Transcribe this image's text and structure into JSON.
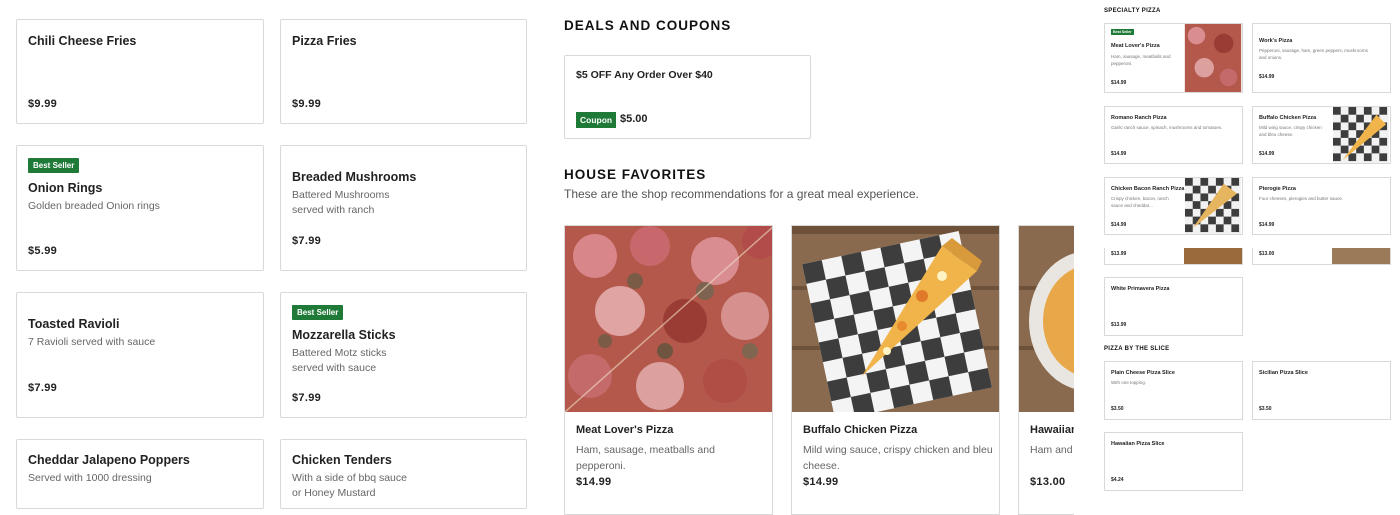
{
  "sides": [
    {
      "title": "Chili Cheese Fries",
      "desc": "",
      "price": "$9.99",
      "badge": ""
    },
    {
      "title": "Pizza Fries",
      "desc": "",
      "price": "$9.99",
      "badge": ""
    },
    {
      "title": "Onion Rings",
      "desc": "Golden breaded Onion rings",
      "price": "$5.99",
      "badge": "Best Seller"
    },
    {
      "title": "Breaded Mushrooms",
      "desc": "Battered Mushrooms served with ranch",
      "price": "$7.99",
      "badge": ""
    },
    {
      "title": "Toasted Ravioli",
      "desc": "7 Ravioli served with sauce",
      "price": "$7.99",
      "badge": ""
    },
    {
      "title": "Mozzarella Sticks",
      "desc": "Battered Motz sticks served with sauce",
      "price": "$7.99",
      "badge": "Best Seller"
    },
    {
      "title": "Cheddar Jalapeno Poppers",
      "desc": "Served with 1000 dressing",
      "price": "",
      "badge": ""
    },
    {
      "title": "Chicken Tenders",
      "desc": "With a side of bbq sauce or Honey Mustard",
      "price": "",
      "badge": ""
    }
  ],
  "deals": {
    "heading": "DEALS AND COUPONS",
    "coupon": {
      "title": "$5 OFF Any Order Over $40",
      "chip": "Coupon",
      "amount": "$5.00"
    }
  },
  "favorites": {
    "heading": "HOUSE FAVORITES",
    "subtitle": "These are the shop recommendations for a great meal experience.",
    "items": [
      {
        "title": "Meat Lover's Pizza",
        "desc": "Ham, sausage, meatballs and pepperoni.",
        "price": "$14.99"
      },
      {
        "title": "Buffalo Chicken Pizza",
        "desc": "Mild wing sauce, crispy chicken and bleu cheese.",
        "price": "$14.99"
      },
      {
        "title": "Hawaiian",
        "desc": "Ham and",
        "price": "$13.00"
      }
    ]
  },
  "mini": {
    "specialty_heading": "SPECIALTY PIZZA",
    "specialty": [
      {
        "title": "Meat Lover's Pizza",
        "desc": "Ham, sausage, meatballs and pepperoni.",
        "price": "$14.99",
        "badge": "Best Seller"
      },
      {
        "title": "Work's Pizza",
        "desc": "Pepperoni, sausage, ham, green peppers, mushrooms and onions.",
        "price": "$14.99",
        "badge": ""
      },
      {
        "title": "Romano Ranch Pizza",
        "desc": "Garlic ranch sauce, spinach, mushrooms and tomatoes.",
        "price": "$14.99",
        "badge": ""
      },
      {
        "title": "Buffalo Chicken Pizza",
        "desc": "Mild wing sauce, crispy chicken and bleu cheese.",
        "price": "$14.99",
        "badge": ""
      },
      {
        "title": "Chicken Bacon Ranch Pizza",
        "desc": "Crispy chicken, bacon, ranch sauce and cheddar...",
        "price": "$14.99",
        "badge": ""
      },
      {
        "title": "Pierogie Pizza",
        "desc": "Four cheeses, pierogies and butter sauce.",
        "price": "$14.99",
        "badge": ""
      },
      {
        "title": "",
        "desc": "",
        "price": "$13.99",
        "badge": ""
      },
      {
        "title": "",
        "desc": "",
        "price": "$13.00",
        "badge": ""
      },
      {
        "title": "White Primavera Pizza",
        "desc": "",
        "price": "$13.99",
        "badge": ""
      }
    ],
    "slice_heading": "PIZZA BY THE SLICE",
    "slices": [
      {
        "title": "Plain Cheese Pizza Slice",
        "desc": "With one topping.",
        "price": "$3.50"
      },
      {
        "title": "Sicilian Pizza Slice",
        "desc": "",
        "price": "$3.50"
      },
      {
        "title": "Hawaiian Pizza Slice",
        "desc": "",
        "price": "$4.24"
      }
    ]
  }
}
